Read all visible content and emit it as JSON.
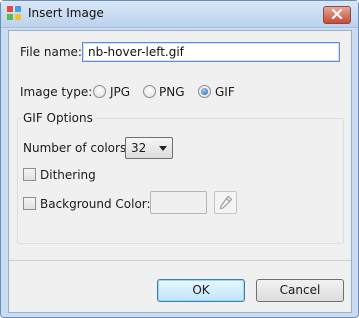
{
  "window": {
    "title": "Insert Image"
  },
  "file": {
    "label": "File name:",
    "value": "nb-hover-left.gif"
  },
  "image_type": {
    "label": "Image type:",
    "options": [
      "JPG",
      "PNG",
      "GIF"
    ],
    "selected": "GIF"
  },
  "gif_options": {
    "title": "GIF Options",
    "colors_label": "Number of colors:",
    "colors_value": "32",
    "dithering_label": "Dithering",
    "dithering_checked": false,
    "background_label": "Background Color:",
    "background_checked": false
  },
  "buttons": {
    "ok": "OK",
    "cancel": "Cancel"
  },
  "colors": {
    "accent": "#3c7fb1",
    "selected_radio": "#1d5fb0"
  }
}
